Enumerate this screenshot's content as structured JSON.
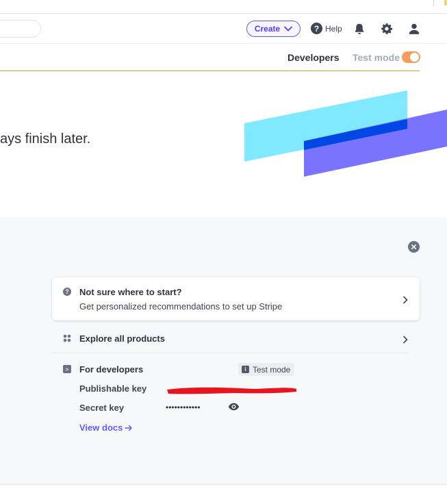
{
  "header": {
    "create_label": "Create",
    "help_label": "Help",
    "icons": [
      "help-icon",
      "bell-icon",
      "gear-icon",
      "user-icon"
    ]
  },
  "subheader": {
    "developers_label": "Developers",
    "test_mode_label": "Test mode",
    "test_mode_on": true
  },
  "hero": {
    "text": "ays finish later."
  },
  "setup": {
    "card": {
      "title": "Not sure where to start?",
      "subtitle": "Get personalized recommendations to set up Stripe"
    },
    "explore_label": "Explore all products",
    "developers": {
      "title": "For developers",
      "badge": "Test mode",
      "publishable_key_label": "Publishable key",
      "secret_key_label": "Secret key",
      "secret_key_masked": "••••••••••••",
      "view_docs_label": "View docs"
    }
  },
  "colors": {
    "accent": "#635bff",
    "toggle": "#f39c5b",
    "hero_cyan": "#80e9ff",
    "hero_blue": "#7a73ff",
    "hero_overlap": "#0048e5",
    "redaction": "#e8141e"
  }
}
